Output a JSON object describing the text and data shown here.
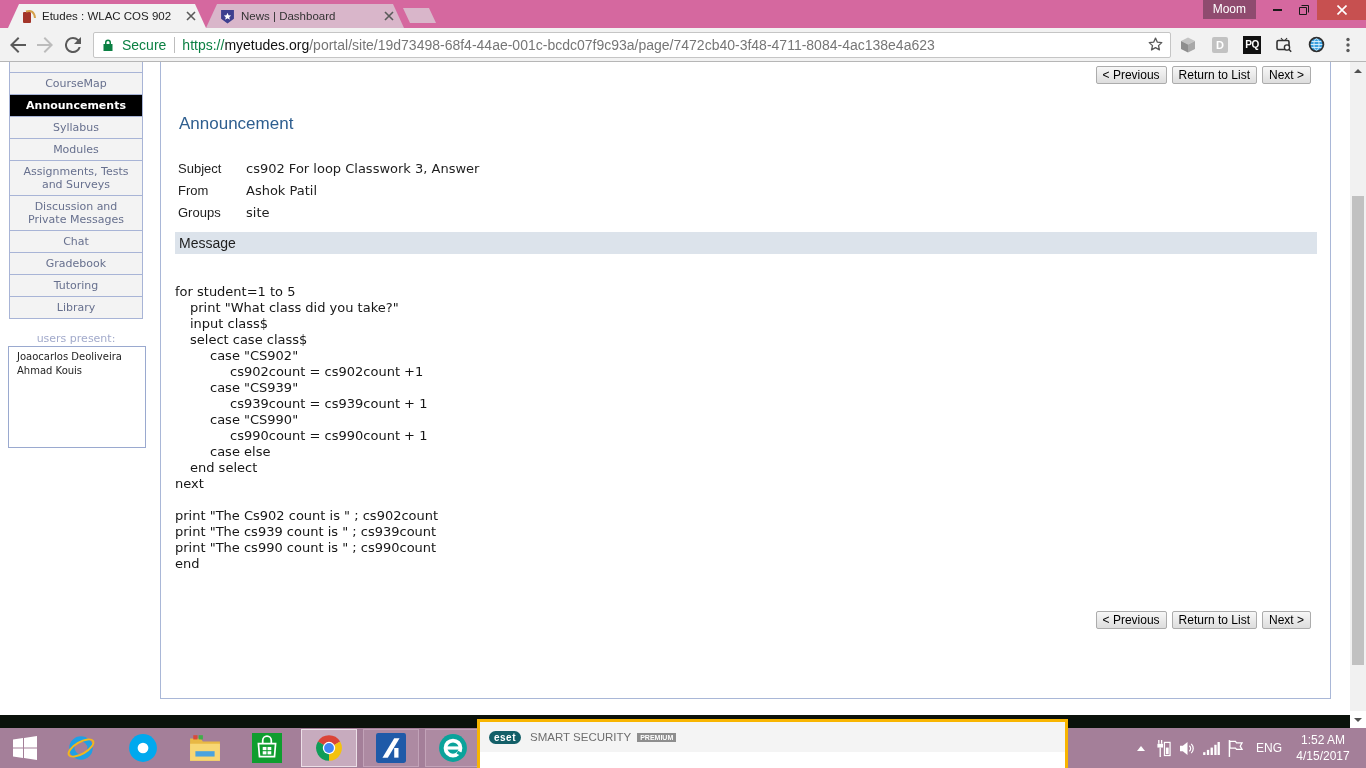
{
  "browser": {
    "tabs": [
      {
        "title": "Etudes : WLAC COS 902",
        "selected": true
      },
      {
        "title": "News | Dashboard",
        "selected": false
      }
    ],
    "titlebar_label": "Moom",
    "address_bar": {
      "security_label": "Secure",
      "url_scheme": "https://",
      "url_host": "myetudes.org",
      "url_path": "/portal/site/19d73498-68f4-44ae-001c-bcdc07f9c93a/page/7472cb40-3f48-4711-8084-4ac138e4a623"
    },
    "extension_badges": [
      "D",
      "PQ"
    ]
  },
  "sidebar": {
    "items": [
      {
        "label": "CourseMap",
        "selected": false
      },
      {
        "label": "Announcements",
        "selected": true
      },
      {
        "label": "Syllabus",
        "selected": false
      },
      {
        "label": "Modules",
        "selected": false
      },
      {
        "label": "Assignments, Tests and Surveys",
        "selected": false
      },
      {
        "label": "Discussion and Private Messages",
        "selected": false
      },
      {
        "label": "Chat",
        "selected": false
      },
      {
        "label": "Gradebook",
        "selected": false
      },
      {
        "label": "Tutoring",
        "selected": false
      },
      {
        "label": "Library",
        "selected": false
      }
    ],
    "users_present": {
      "title": "users present:",
      "users": [
        "Joaocarlos Deoliveira",
        "Ahmad Kouis"
      ]
    }
  },
  "announcement": {
    "nav_buttons_top": [
      "< Previous",
      "Return to List",
      "Next >"
    ],
    "title": "Announcement",
    "fields": [
      {
        "label": "Subject",
        "value": "cs902 For loop Classwork 3, Answer"
      },
      {
        "label": "From",
        "value": "Ashok Patil"
      },
      {
        "label": "Groups",
        "value": "site"
      }
    ],
    "message_header": "Message",
    "message_blocks": [
      {
        "lines": [
          {
            "text": "for student=1 to 5",
            "children": [
              {
                "text": "print \"What class did you take?\""
              },
              {
                "text": "input class$"
              },
              {
                "text": "select case class$",
                "children": [
                  {
                    "text": "case \"CS902\"",
                    "children": [
                      {
                        "text": "cs902count = cs902count +1"
                      }
                    ]
                  },
                  {
                    "text": "case \"CS939\"",
                    "children": [
                      {
                        "text": "cs939count = cs939count + 1"
                      }
                    ]
                  },
                  {
                    "text": "case \"CS990\"",
                    "children": [
                      {
                        "text": "cs990count = cs990count + 1"
                      }
                    ]
                  },
                  {
                    "text": "case else"
                  }
                ]
              },
              {
                "text": "end select"
              }
            ]
          },
          {
            "text": "next"
          }
        ]
      },
      {
        "lines": [
          {
            "text": "print \"The Cs902 count is \" ; cs902count"
          },
          {
            "text": "print \"The cs939 count is \" ; cs939count"
          },
          {
            "text": "print \"The cs990 count is \" ; cs990count"
          },
          {
            "text": "end"
          }
        ]
      }
    ],
    "nav_buttons_bottom": [
      "< Previous",
      "Return to List",
      "Next >"
    ]
  },
  "taskbar": {
    "apps": [
      {
        "running": false,
        "selected": false
      },
      {
        "running": false,
        "selected": false
      },
      {
        "running": false,
        "selected": false
      },
      {
        "running": false,
        "selected": false
      },
      {
        "running": true,
        "selected": true
      },
      {
        "running": true,
        "selected": false
      },
      {
        "running": true,
        "selected": false
      }
    ],
    "tray": {
      "language": "ENG",
      "time": "1:52 AM",
      "date": "4/15/2017"
    }
  },
  "notification": {
    "logo_text": "eset",
    "product": "SMART SECURITY",
    "badge": "PREMIUM"
  }
}
